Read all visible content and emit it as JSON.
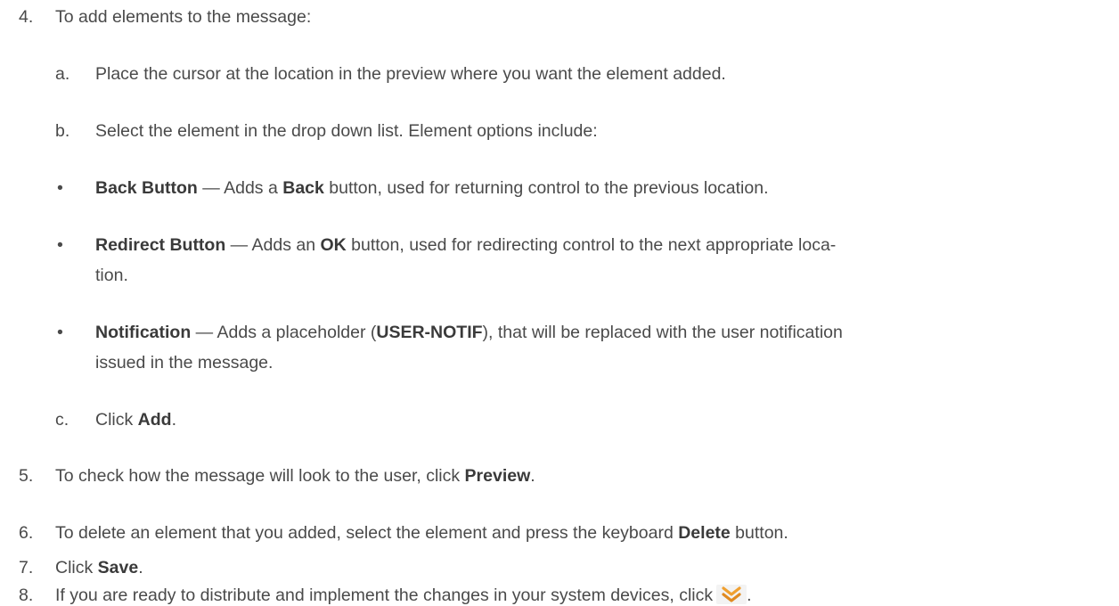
{
  "steps": {
    "s4": {
      "num": "4.",
      "text": "To add elements to the message:"
    },
    "s4a": {
      "letter": "a.",
      "text": "Place the cursor at the location in the preview where you want the element added."
    },
    "s4b": {
      "letter": "b.",
      "text": "Select the element in the drop down list. Element options include:"
    },
    "bullets": [
      {
        "mark": "•",
        "term": "Back Button",
        "t1": " — Adds a ",
        "b1": "Back",
        "t2": " button, used for returning control to the previous location."
      },
      {
        "mark": "•",
        "term": "Redirect Button",
        "t1": " — Adds an ",
        "b1": "OK",
        "t2": " button, used for redirecting control to the next appropriate loca-",
        "cont": "tion."
      },
      {
        "mark": "•",
        "term": "Notification",
        "t1": " — Adds a placeholder (",
        "b1": "USER-NOTIF",
        "t2": "), that will be replaced with the user notification",
        "cont": "issued in the message."
      }
    ],
    "s4c": {
      "letter": "c.",
      "t1": "Click ",
      "b1": "Add",
      "t2": "."
    },
    "s5": {
      "num": "5.",
      "t1": "To check how the message will look to the user, click ",
      "b1": "Preview",
      "t2": "."
    },
    "s6": {
      "num": "6.",
      "t1": "To delete an element that you added, select the element and press the keyboard ",
      "b1": "Delete",
      "t2": " button."
    },
    "s7": {
      "num": "7.",
      "t1": "Click ",
      "b1": "Save",
      "t2": "."
    },
    "s8": {
      "num": "8.",
      "t1": "If you are ready to distribute and implement the changes in your system devices, click",
      "t2": "."
    }
  },
  "icons": {
    "distribute": "double-chevron-down-icon",
    "accent": "#f0a030"
  }
}
